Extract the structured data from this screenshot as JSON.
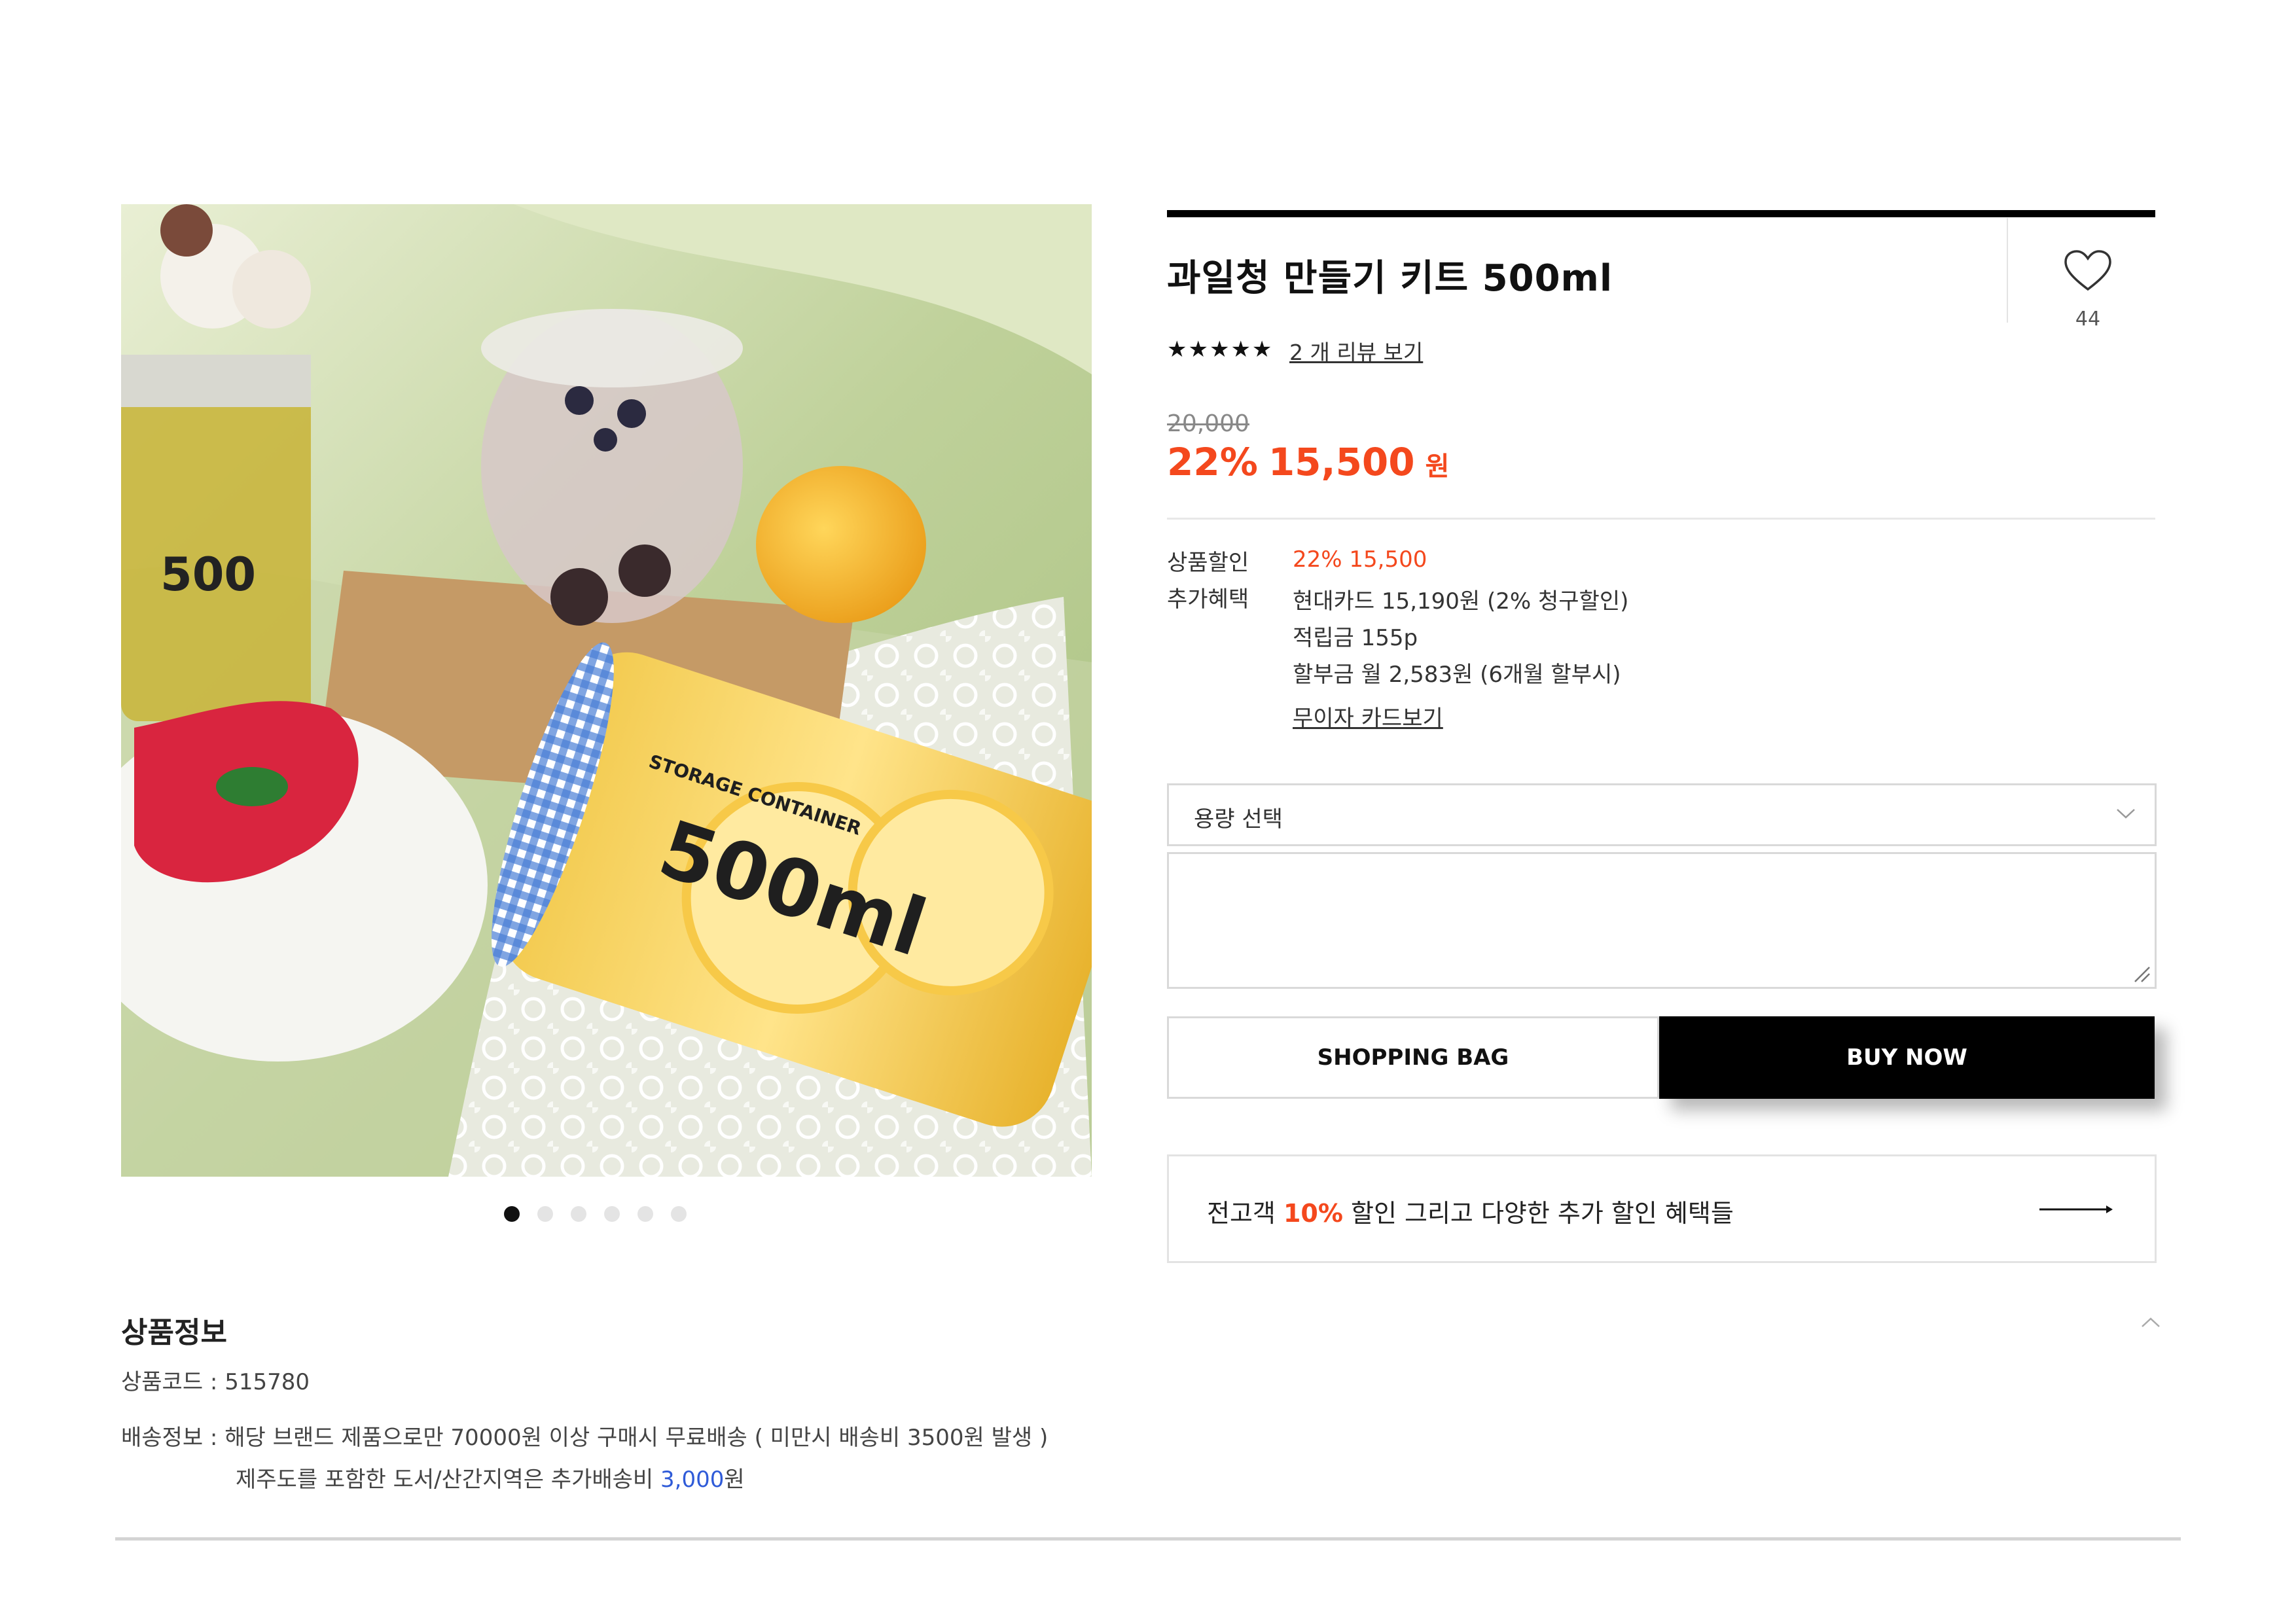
{
  "product": {
    "title": "과일청 만들기 키트 500ml",
    "wish_count": "44",
    "stars": "★★★★★",
    "review_link": "2 개 리뷰 보기",
    "original_price": "20,000",
    "discount_percent": "22%",
    "sale_price": "15,500",
    "currency": "원",
    "image_jar_label": "500ml",
    "image_jar_sublabel": "STORAGE CONTAINER",
    "image_dots": {
      "count": 6,
      "active_index": 0
    }
  },
  "benefits": {
    "discount_label": "상품할인",
    "discount_value": "22% 15,500",
    "extra_label": "추가혜택",
    "extra_card": "현대카드 15,190원 (2% 청구할인)",
    "extra_points": "적립금 155p",
    "extra_installment": "할부금 월 2,583원 (6개월 할부시)",
    "card_link": "무이자 카드보기"
  },
  "options": {
    "select_label": "용량 선택",
    "textarea_value": ""
  },
  "actions": {
    "shopping_bag": "SHOPPING BAG",
    "buy_now": "BUY NOW"
  },
  "promo": {
    "prefix": "전고객 ",
    "accent": "10%",
    "suffix": " 할인 그리고 다양한 추가 할인 혜택들"
  },
  "info": {
    "title": "상품정보",
    "code_label": "상품코드 : ",
    "code_value": "515780",
    "shipping_label": "배송정보 : ",
    "shipping_text": "해당 브랜드 제품으로만 70000원 이상 구매시 무료배송 ( 미만시 배송비 3500원 발생 )",
    "shipping_extra_prefix": "제주도를 포함한 도서/산간지역은 추가배송비 ",
    "shipping_extra_amount": "3,000",
    "shipping_extra_suffix": "원"
  },
  "icons": {
    "wishlist": "heart-icon",
    "select": "chevron-down-icon",
    "promo": "arrow-right-icon",
    "info": "chevron-up-icon",
    "resize": "resize-grip-icon"
  },
  "colors": {
    "accent": "#f4481d",
    "blue": "#2f5bd8",
    "black": "#000000"
  }
}
